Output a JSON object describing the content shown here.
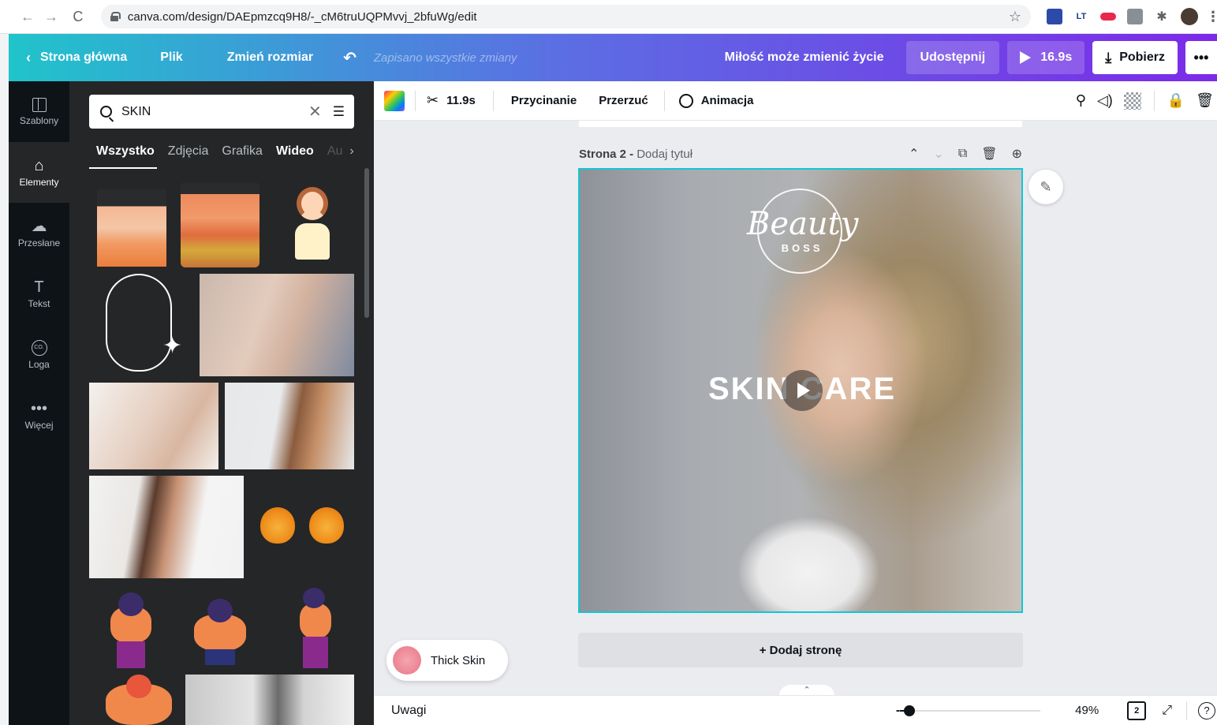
{
  "browser": {
    "url": "canva.com/design/DAEpmzcq9H8/-_cM6truUQPMvvj_2bfuWg/edit",
    "back_icon": "←",
    "forward_icon": "→",
    "reload_icon": "C",
    "star_icon": "☆",
    "ext_puzzle_icon": "✱",
    "menu_icon": "⋮"
  },
  "header": {
    "home_label": "Strona główna",
    "home_chevron": "‹",
    "file_label": "Plik",
    "resize_label": "Zmień rozmiar",
    "undo_icon": "↶",
    "saved_status": "Zapisano wszystkie zmiany",
    "design_title": "Miłość może zmienić życie",
    "share_label": "Udostępnij",
    "play_duration": "16.9s",
    "download_icon": "⤓",
    "download_label": "Pobierz",
    "more_icon": "•••",
    "gradient_colors": [
      "#20c4cb",
      "#5b6fe3",
      "#7d2ae8"
    ]
  },
  "left_rail": {
    "items": [
      {
        "label": "Szablony",
        "icon": "templates-icon"
      },
      {
        "label": "Elementy",
        "icon": "elements-icon",
        "glyph": "⌂"
      },
      {
        "label": "Przesłane",
        "icon": "upload-cloud-icon",
        "glyph": "☁"
      },
      {
        "label": "Tekst",
        "icon": "text-icon",
        "glyph": "T"
      },
      {
        "label": "Loga",
        "icon": "logo-icon",
        "glyph": "CO."
      },
      {
        "label": "Więcej",
        "icon": "more-icon",
        "glyph": "•••"
      }
    ],
    "active": "Elementy"
  },
  "side_panel": {
    "search_value": "SKIN",
    "clear_icon": "✕",
    "filter_icon": "☰",
    "tabs": [
      "Wszystko",
      "Zdjęcia",
      "Grafika",
      "Wideo",
      "Au"
    ],
    "active_tab": "Wszystko",
    "tabs_more_icon": "›",
    "collapse_icon": "‹"
  },
  "toolbar": {
    "scissors_icon": "✂",
    "duration": "11.9s",
    "crop_label": "Przycinanie",
    "flip_label": "Przerzuć",
    "animate_label": "Animacja",
    "paint_icon": "⚲",
    "volume_icon": "◁)",
    "lock_icon": "🔒",
    "trash_icon": "🗑"
  },
  "canvas": {
    "page_number": "Strona 2 -",
    "page_title_placeholder": "Dodaj tytuł",
    "page_action_up": "⌃",
    "page_action_down": "⌄",
    "page_action_duplicate": "⧉",
    "page_action_delete": "🗑",
    "page_action_add": "⊕",
    "brand_script": "Beauty",
    "brand_sub": "BOSS",
    "headline": "SKIN CARE",
    "comment_icon": "✎",
    "add_page_label": "+ Dodaj stronę",
    "toast_label": "Thick Skin",
    "pages_toggle_icon": "⌃",
    "selection_color": "#13c7d4"
  },
  "footer": {
    "notes_label": "Uwagi",
    "zoom_minus": "-",
    "zoom_level_fraction": 0.07,
    "zoom_value": "49%",
    "page_count": "2",
    "fullscreen_icon": "⤢",
    "help_icon": "?"
  }
}
